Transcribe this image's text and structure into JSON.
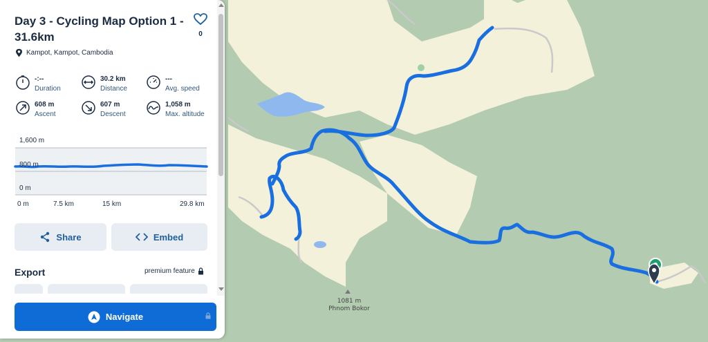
{
  "route": {
    "title": "Day 3 - Cycling Map Option 1 - 31.6km",
    "favorite_count": "0",
    "location": "Kampot, Kampot, Cambodia"
  },
  "stats": [
    {
      "icon": "clock-icon",
      "value": "-:--",
      "label": "Duration"
    },
    {
      "icon": "distance-arrows-icon",
      "value": "30.2 km",
      "label": "Distance"
    },
    {
      "icon": "speedometer-icon",
      "value": "---",
      "label": "Avg. speed"
    },
    {
      "icon": "ascent-arrow-icon",
      "value": "608 m",
      "label": "Ascent"
    },
    {
      "icon": "descent-arrow-icon",
      "value": "607 m",
      "label": "Descent"
    },
    {
      "icon": "altitude-wave-icon",
      "value": "1,058 m",
      "label": "Max. altitude"
    }
  ],
  "elevation_profile": {
    "y_labels": [
      "1,600 m",
      "800 m",
      "0 m"
    ],
    "x_labels": [
      "0 m",
      "7.5 km",
      "15 km",
      "29.8 km"
    ]
  },
  "actions": {
    "share_label": "Share",
    "embed_label": "Embed"
  },
  "export": {
    "heading": "Export",
    "premium_label": "premium feature"
  },
  "navigate": {
    "label": "Navigate"
  },
  "map": {
    "peak_elevation": "1081 m",
    "peak_name": "Phnom Bokor",
    "route_color": "#1a6fe0",
    "forest_color": "#b3cbb0",
    "open_land_color": "#f3f1da",
    "water_color": "#8fb8ee",
    "end_marker_color": "#2f3d4f",
    "start_marker_color": "#1e9e6e"
  }
}
